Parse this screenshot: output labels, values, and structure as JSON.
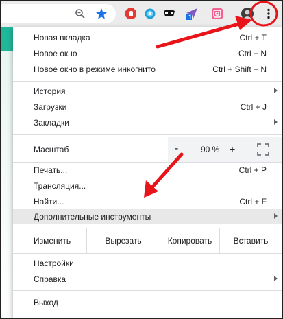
{
  "menu": {
    "new_tab": {
      "label": "Новая вкладка",
      "shortcut": "Ctrl + T"
    },
    "new_window": {
      "label": "Новое окно",
      "shortcut": "Ctrl + N"
    },
    "incognito": {
      "label": "Новое окно в режиме инкогнито",
      "shortcut": "Ctrl + Shift + N"
    },
    "history": {
      "label": "История"
    },
    "downloads": {
      "label": "Загрузки",
      "shortcut": "Ctrl + J"
    },
    "bookmarks": {
      "label": "Закладки"
    },
    "zoom": {
      "label": "Масштаб",
      "minus": "-",
      "value": "90 %",
      "plus": "+"
    },
    "print": {
      "label": "Печать...",
      "shortcut": "Ctrl + P"
    },
    "cast": {
      "label": "Трансляция..."
    },
    "find": {
      "label": "Найти...",
      "shortcut": "Ctrl + F"
    },
    "more_tools": {
      "label": "Дополнительные инструменты"
    },
    "edit": {
      "label": "Изменить",
      "cut": "Вырезать",
      "copy": "Копировать",
      "paste": "Вставить"
    },
    "settings": {
      "label": "Настройки"
    },
    "help": {
      "label": "Справка"
    },
    "exit": {
      "label": "Выход"
    }
  },
  "toolbar": {
    "extension_badge": "1"
  },
  "colors": {
    "annotation_red": "#e8141a",
    "star_blue": "#1a73e8",
    "highlight": "#e8e8e8"
  },
  "icons": [
    "zoom-icon",
    "bookmark-star-icon",
    "adblock-icon",
    "globe-icon",
    "incognito-mask-icon",
    "send-extension-icon",
    "instagram-icon",
    "profile-avatar-icon",
    "kebab-menu-icon"
  ]
}
